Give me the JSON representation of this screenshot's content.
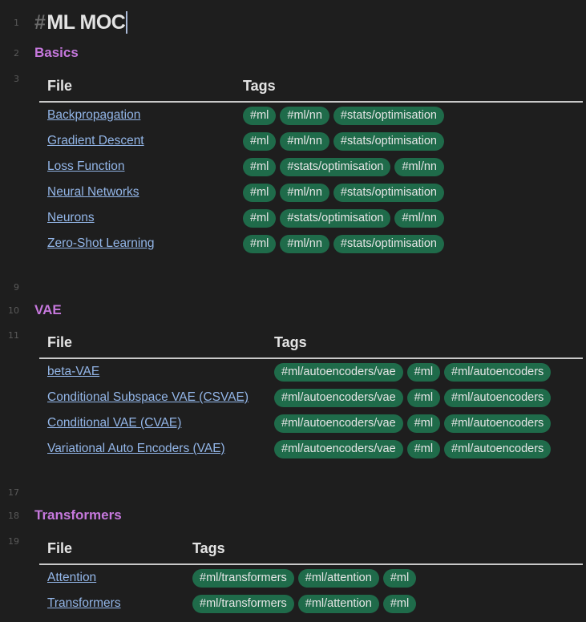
{
  "line_numbers": [
    "1",
    "2",
    "3",
    "9",
    "10",
    "11",
    "17",
    "18",
    "19"
  ],
  "title": {
    "hash": "#",
    "text": "ML MOC"
  },
  "sections": [
    {
      "heading": "Basics",
      "columns": [
        "File",
        "Tags"
      ],
      "rows": [
        {
          "file": "Backpropagation",
          "tags": [
            "#ml",
            "#ml/nn",
            "#stats/optimisation"
          ]
        },
        {
          "file": "Gradient Descent",
          "tags": [
            "#ml",
            "#ml/nn",
            "#stats/optimisation"
          ]
        },
        {
          "file": "Loss Function",
          "tags": [
            "#ml",
            "#stats/optimisation",
            "#ml/nn"
          ]
        },
        {
          "file": "Neural Networks",
          "tags": [
            "#ml",
            "#ml/nn",
            "#stats/optimisation"
          ]
        },
        {
          "file": "Neurons",
          "tags": [
            "#ml",
            "#stats/optimisation",
            "#ml/nn"
          ]
        },
        {
          "file": "Zero-Shot Learning",
          "tags": [
            "#ml",
            "#ml/nn",
            "#stats/optimisation"
          ]
        }
      ]
    },
    {
      "heading": "VAE",
      "columns": [
        "File",
        "Tags"
      ],
      "rows": [
        {
          "file": "beta-VAE",
          "tags": [
            "#ml/autoencoders/vae",
            "#ml",
            "#ml/autoencoders"
          ]
        },
        {
          "file": "Conditional Subspace VAE (CSVAE)",
          "tags": [
            "#ml/autoencoders/vae",
            "#ml",
            "#ml/autoencoders"
          ]
        },
        {
          "file": "Conditional VAE (CVAE)",
          "tags": [
            "#ml/autoencoders/vae",
            "#ml",
            "#ml/autoencoders"
          ]
        },
        {
          "file": "Variational Auto Encoders (VAE)",
          "tags": [
            "#ml/autoencoders/vae",
            "#ml",
            "#ml/autoencoders"
          ]
        }
      ]
    },
    {
      "heading": "Transformers",
      "columns": [
        "File",
        "Tags"
      ],
      "rows": [
        {
          "file": "Attention",
          "tags": [
            "#ml/transformers",
            "#ml/attention",
            "#ml"
          ]
        },
        {
          "file": "Transformers",
          "tags": [
            "#ml/transformers",
            "#ml/attention",
            "#ml"
          ]
        }
      ]
    }
  ],
  "colors": {
    "background": "#1e1e1e",
    "heading": "#c678dd",
    "link": "#93b6e8",
    "tag_bg": "#1f6b4a",
    "text": "#e4e4e4"
  }
}
